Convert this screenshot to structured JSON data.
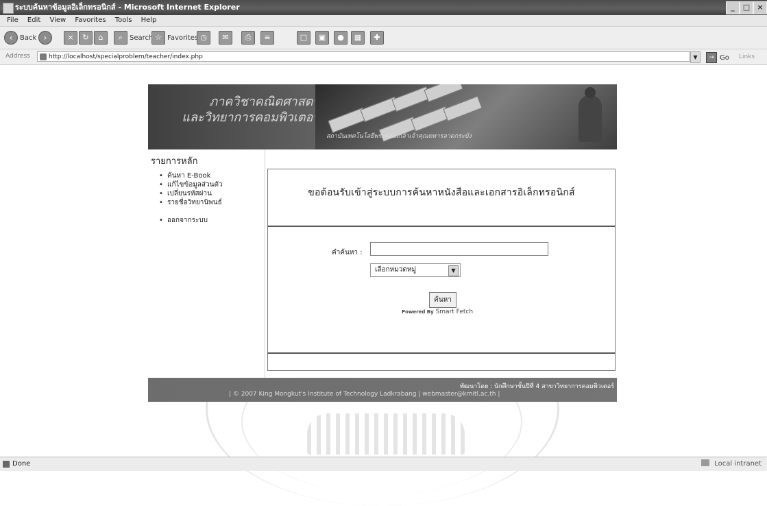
{
  "window": {
    "title": "ระบบค้นหาข้อมูลอิเล็กทรอนิกส์ - Microsoft Internet Explorer"
  },
  "menu": [
    "File",
    "Edit",
    "View",
    "Favorites",
    "Tools",
    "Help"
  ],
  "toolbar": {
    "back": "Back",
    "search": "Search",
    "favorites": "Favorites"
  },
  "address": {
    "label": "Address",
    "url": "http://localhost/specialproblem/teacher/index.php",
    "go": "Go",
    "links": "Links"
  },
  "banner": {
    "line1": "ภาควิชาคณิตศาสตร์",
    "line2": "และวิทยาการคอมพิวเตอร์",
    "caption": "สถาบันเทคโนโลยีพระจอมเกล้าเจ้าคุณทหารลาดกระบัง"
  },
  "nav": {
    "title": "รายการหลัก",
    "items": [
      "ค้นหา E-Book",
      "แก้ไขข้อมูลส่วนตัว",
      "เปลี่ยนรหัสผ่าน",
      "รายชื่อวิทยานิพนธ์"
    ],
    "logout": "ออกจากระบบ"
  },
  "main": {
    "headline": "ขอต้อนรับเข้าสู่ระบบการค้นหาหนังสือและเอกสารอิเล็กทรอนิกส์",
    "search_label": "คำค้นหา :",
    "category_placeholder": "เลือกหมวดหมู่",
    "search_button": "ค้นหา",
    "powered_prefix": "Powered By",
    "powered_name": "Smart Fetch"
  },
  "footer": {
    "line1": "พัฒนาโดย : นักศึกษาชั้นปีที่ 4 สาขาวิทยาการคอมพิวเตอร์",
    "line2": "| © 2007 King Mongkut's Institute of Technology Ladkrabang | webmaster@kmitl.ac.th |"
  },
  "status": {
    "left": "Done",
    "zone": "Local intranet"
  }
}
